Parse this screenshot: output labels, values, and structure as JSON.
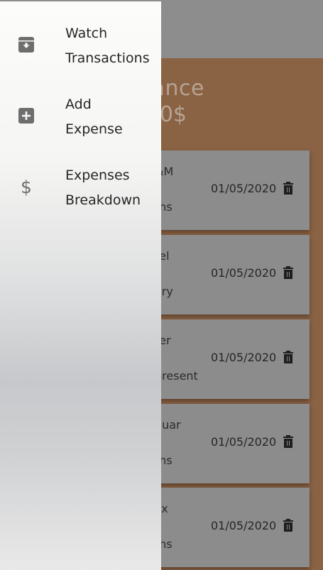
{
  "drawer": {
    "items": [
      {
        "line1": "Watch",
        "line2": "Transactions",
        "icon": "archive-icon"
      },
      {
        "line1": "Add",
        "line2": "Expense",
        "icon": "add-box-icon"
      },
      {
        "line1": "Expenses",
        "line2": "Breakdown",
        "icon": "dollar-icon",
        "glyph": "$"
      }
    ]
  },
  "balance": {
    "label_fragment": "ance",
    "value_fragment": "0$"
  },
  "transactions": [
    {
      "name": "&M",
      "category": "ths",
      "date": "01/05/2020"
    },
    {
      "name": "tel",
      "category": "ary",
      "date": "01/05/2020"
    },
    {
      "name": "ter",
      "category": "present",
      "date": "01/05/2020"
    },
    {
      "name": "nuar",
      "category": "ths",
      "date": "01/05/2020"
    },
    {
      "name": "ox",
      "category": "ths",
      "date": "01/05/2020"
    }
  ],
  "colors": {
    "overlay": "#8f8f8f",
    "balance_bg": "#8a6244",
    "drawer_icon": "#6e6e6e"
  }
}
